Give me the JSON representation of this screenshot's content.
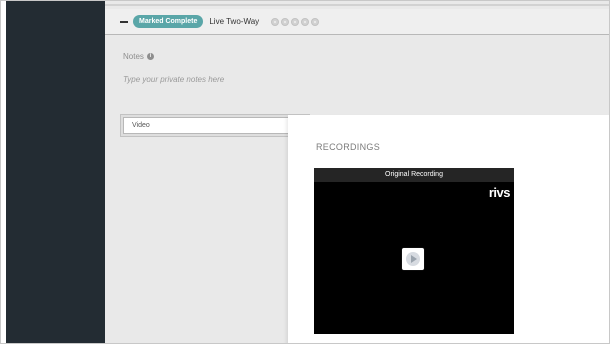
{
  "status": {
    "badge_label": "Marked Complete",
    "mode_label": "Live Two-Way",
    "rating_dots": 5,
    "colors": {
      "badge": "#5aa6a8"
    }
  },
  "notes": {
    "label": "Notes",
    "info_icon": "info-icon",
    "placeholder": "Type your private notes here"
  },
  "filter": {
    "selected": "Video"
  },
  "recordings": {
    "title": "RECORDINGS",
    "video": {
      "header_label": "Original Recording",
      "logo_text": "rivs",
      "play_icon": "play-icon"
    }
  }
}
